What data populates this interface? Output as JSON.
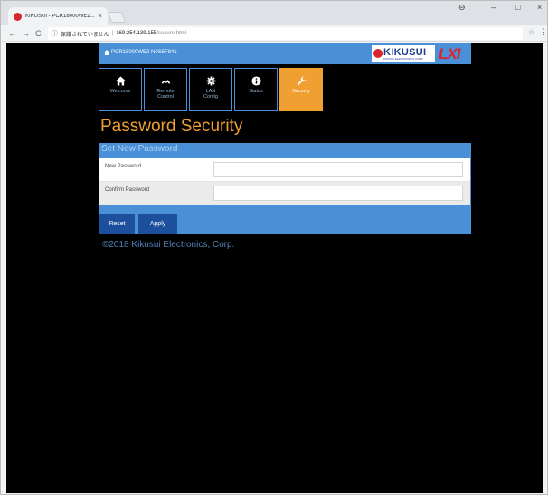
{
  "browser": {
    "tab_title": "KIKUSUI - PCR18000WE2...",
    "tab_close": "×",
    "controls": {
      "user": "⊖",
      "minimize": "–",
      "maximize": "□",
      "close": "×"
    },
    "nav": {
      "back": "←",
      "forward": "→",
      "reload": "C"
    },
    "security_text": "保護されていません",
    "url_host": "169.254.139.155",
    "url_path": "/secure.html",
    "info_icon": "ⓘ",
    "star": "☆",
    "menu": "⋮"
  },
  "header": {
    "model": "PCR18000WE2 N0S5F841",
    "logo_text": "KIKUSUI",
    "logo_sub": "KIKUSUI ELECTRONICS CORP.",
    "lxi": "LXI"
  },
  "nav_buttons": [
    {
      "label": "Welcome",
      "icon": "home-icon"
    },
    {
      "label": "Remote Control",
      "icon": "gauge-icon"
    },
    {
      "label": "LAN Config",
      "icon": "gear-icon"
    },
    {
      "label": "Status",
      "icon": "info-icon"
    },
    {
      "label": "Security",
      "icon": "wrench-icon",
      "active": true
    }
  ],
  "page_title": "Password Security",
  "panel": {
    "title": "Set New Password",
    "fields": [
      {
        "label": "New Password",
        "value": ""
      },
      {
        "label": "Confirm Password",
        "value": ""
      }
    ],
    "reset_label": "Reset",
    "apply_label": "Apply"
  },
  "copyright": "©2018 Kikusui Electronics, Corp.",
  "colors": {
    "accent": "#f0a030",
    "blue": "#4a90d9",
    "button": "#1c4f9c",
    "background": "#000000"
  }
}
